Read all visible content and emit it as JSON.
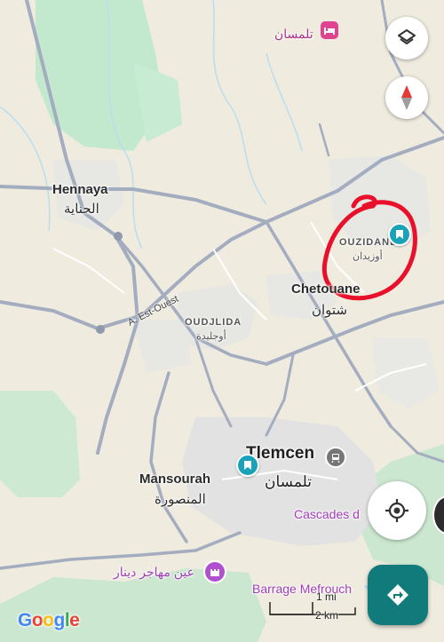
{
  "labels": {
    "tlemcen_top": "تلمسان",
    "hennaya": "Hennaya",
    "hennaya_ar": "الحناية",
    "ouzidane": "OUZIDANE",
    "ouzidane_ar": "أوزيدان",
    "chetouane": "Chetouane",
    "chetouane_ar": "شتوان",
    "oudjlida": "OUDJLIDA",
    "oudjlida_ar": "أوجليدة",
    "tlemcen": "Tlemcen",
    "tlemcen_ar": "تلمسان",
    "mansourah": "Mansourah",
    "mansourah_ar": "المنصورة",
    "cascades": "Cascades d",
    "ain_mehadjer": "عين مهاجر دينار",
    "barrage": "Barrage Mefrouch",
    "road_a": "A. Est-Ouest"
  },
  "scale": {
    "top": "1 mi",
    "bottom": "2 km"
  },
  "brand": {
    "g": "G",
    "o1": "o",
    "o2": "o",
    "g2": "g",
    "l": "l",
    "e": "e"
  },
  "colors": {
    "accent": "#117a7a",
    "annotation": "#e8102a",
    "water": "#b9def0",
    "park": "#c2e8cd"
  },
  "icons": [
    "layers-icon",
    "compass-icon",
    "my-location-icon",
    "directions-icon",
    "bookmark-pin-icon",
    "hotel-icon",
    "castle-icon",
    "tram-icon"
  ]
}
